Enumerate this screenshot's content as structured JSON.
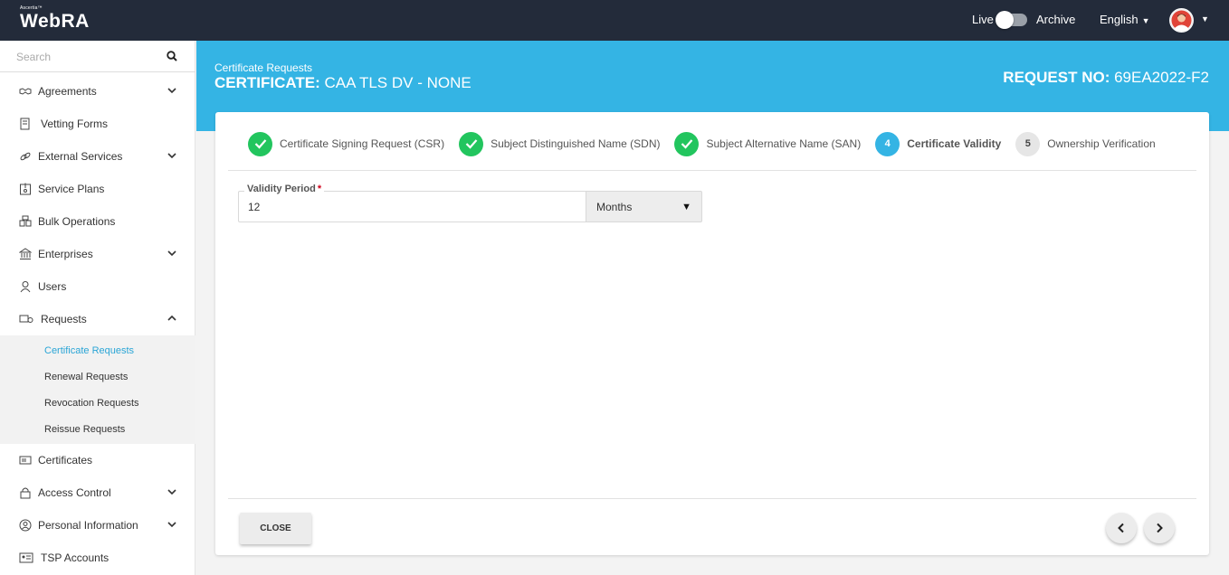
{
  "header": {
    "brand_small": "Ascertia™",
    "brand_name": "WebRA",
    "live_label": "Live",
    "archive_label": "Archive",
    "language": "English"
  },
  "sidebar": {
    "search_placeholder": "Search",
    "items": [
      {
        "label": "Agreements",
        "icon": "handshake-icon",
        "expandable": true
      },
      {
        "label": "Vetting Forms",
        "icon": "form-icon",
        "expandable": false
      },
      {
        "label": "External Services",
        "icon": "link-icon",
        "expandable": true
      },
      {
        "label": "Service Plans",
        "icon": "plan-icon",
        "expandable": false
      },
      {
        "label": "Bulk Operations",
        "icon": "bulk-icon",
        "expandable": false
      },
      {
        "label": "Enterprises",
        "icon": "bank-icon",
        "expandable": true
      },
      {
        "label": "Users",
        "icon": "user-icon",
        "expandable": false
      },
      {
        "label": "Requests",
        "icon": "requests-icon",
        "expandable": true,
        "expanded": true
      }
    ],
    "request_subitems": [
      {
        "label": "Certificate Requests",
        "active": true
      },
      {
        "label": "Renewal Requests"
      },
      {
        "label": "Revocation Requests"
      },
      {
        "label": "Reissue Requests"
      }
    ],
    "items_after": [
      {
        "label": "Certificates",
        "icon": "certificate-icon",
        "expandable": false
      },
      {
        "label": "Access Control",
        "icon": "lock-icon",
        "expandable": true
      },
      {
        "label": "Personal Information",
        "icon": "person-circle-icon",
        "expandable": true
      },
      {
        "label": "TSP Accounts",
        "icon": "id-card-icon",
        "expandable": false
      }
    ]
  },
  "page": {
    "breadcrumb": "Certificate Requests",
    "title_prefix": "CERTIFICATE:",
    "title_value": "CAA TLS DV - NONE",
    "request_prefix": "REQUEST NO:",
    "request_value": "69EA2022-F2"
  },
  "steps": [
    {
      "label": "Certificate Signing Request (CSR)",
      "status": "done"
    },
    {
      "label": "Subject Distinguished Name (SDN)",
      "status": "done"
    },
    {
      "label": "Subject Alternative Name (SAN)",
      "status": "done"
    },
    {
      "number": "4",
      "label": "Certificate Validity",
      "status": "current"
    },
    {
      "number": "5",
      "label": "Ownership Verification",
      "status": "pending"
    }
  ],
  "form": {
    "validity_label": "Validity Period",
    "required_mark": "*",
    "validity_value": "12",
    "unit": "Months"
  },
  "footer": {
    "close_label": "CLOSE"
  },
  "colors": {
    "topbar": "#232b3a",
    "banner": "#34b4e4",
    "step_done": "#22c55e",
    "active_link": "#2aa5d6"
  }
}
